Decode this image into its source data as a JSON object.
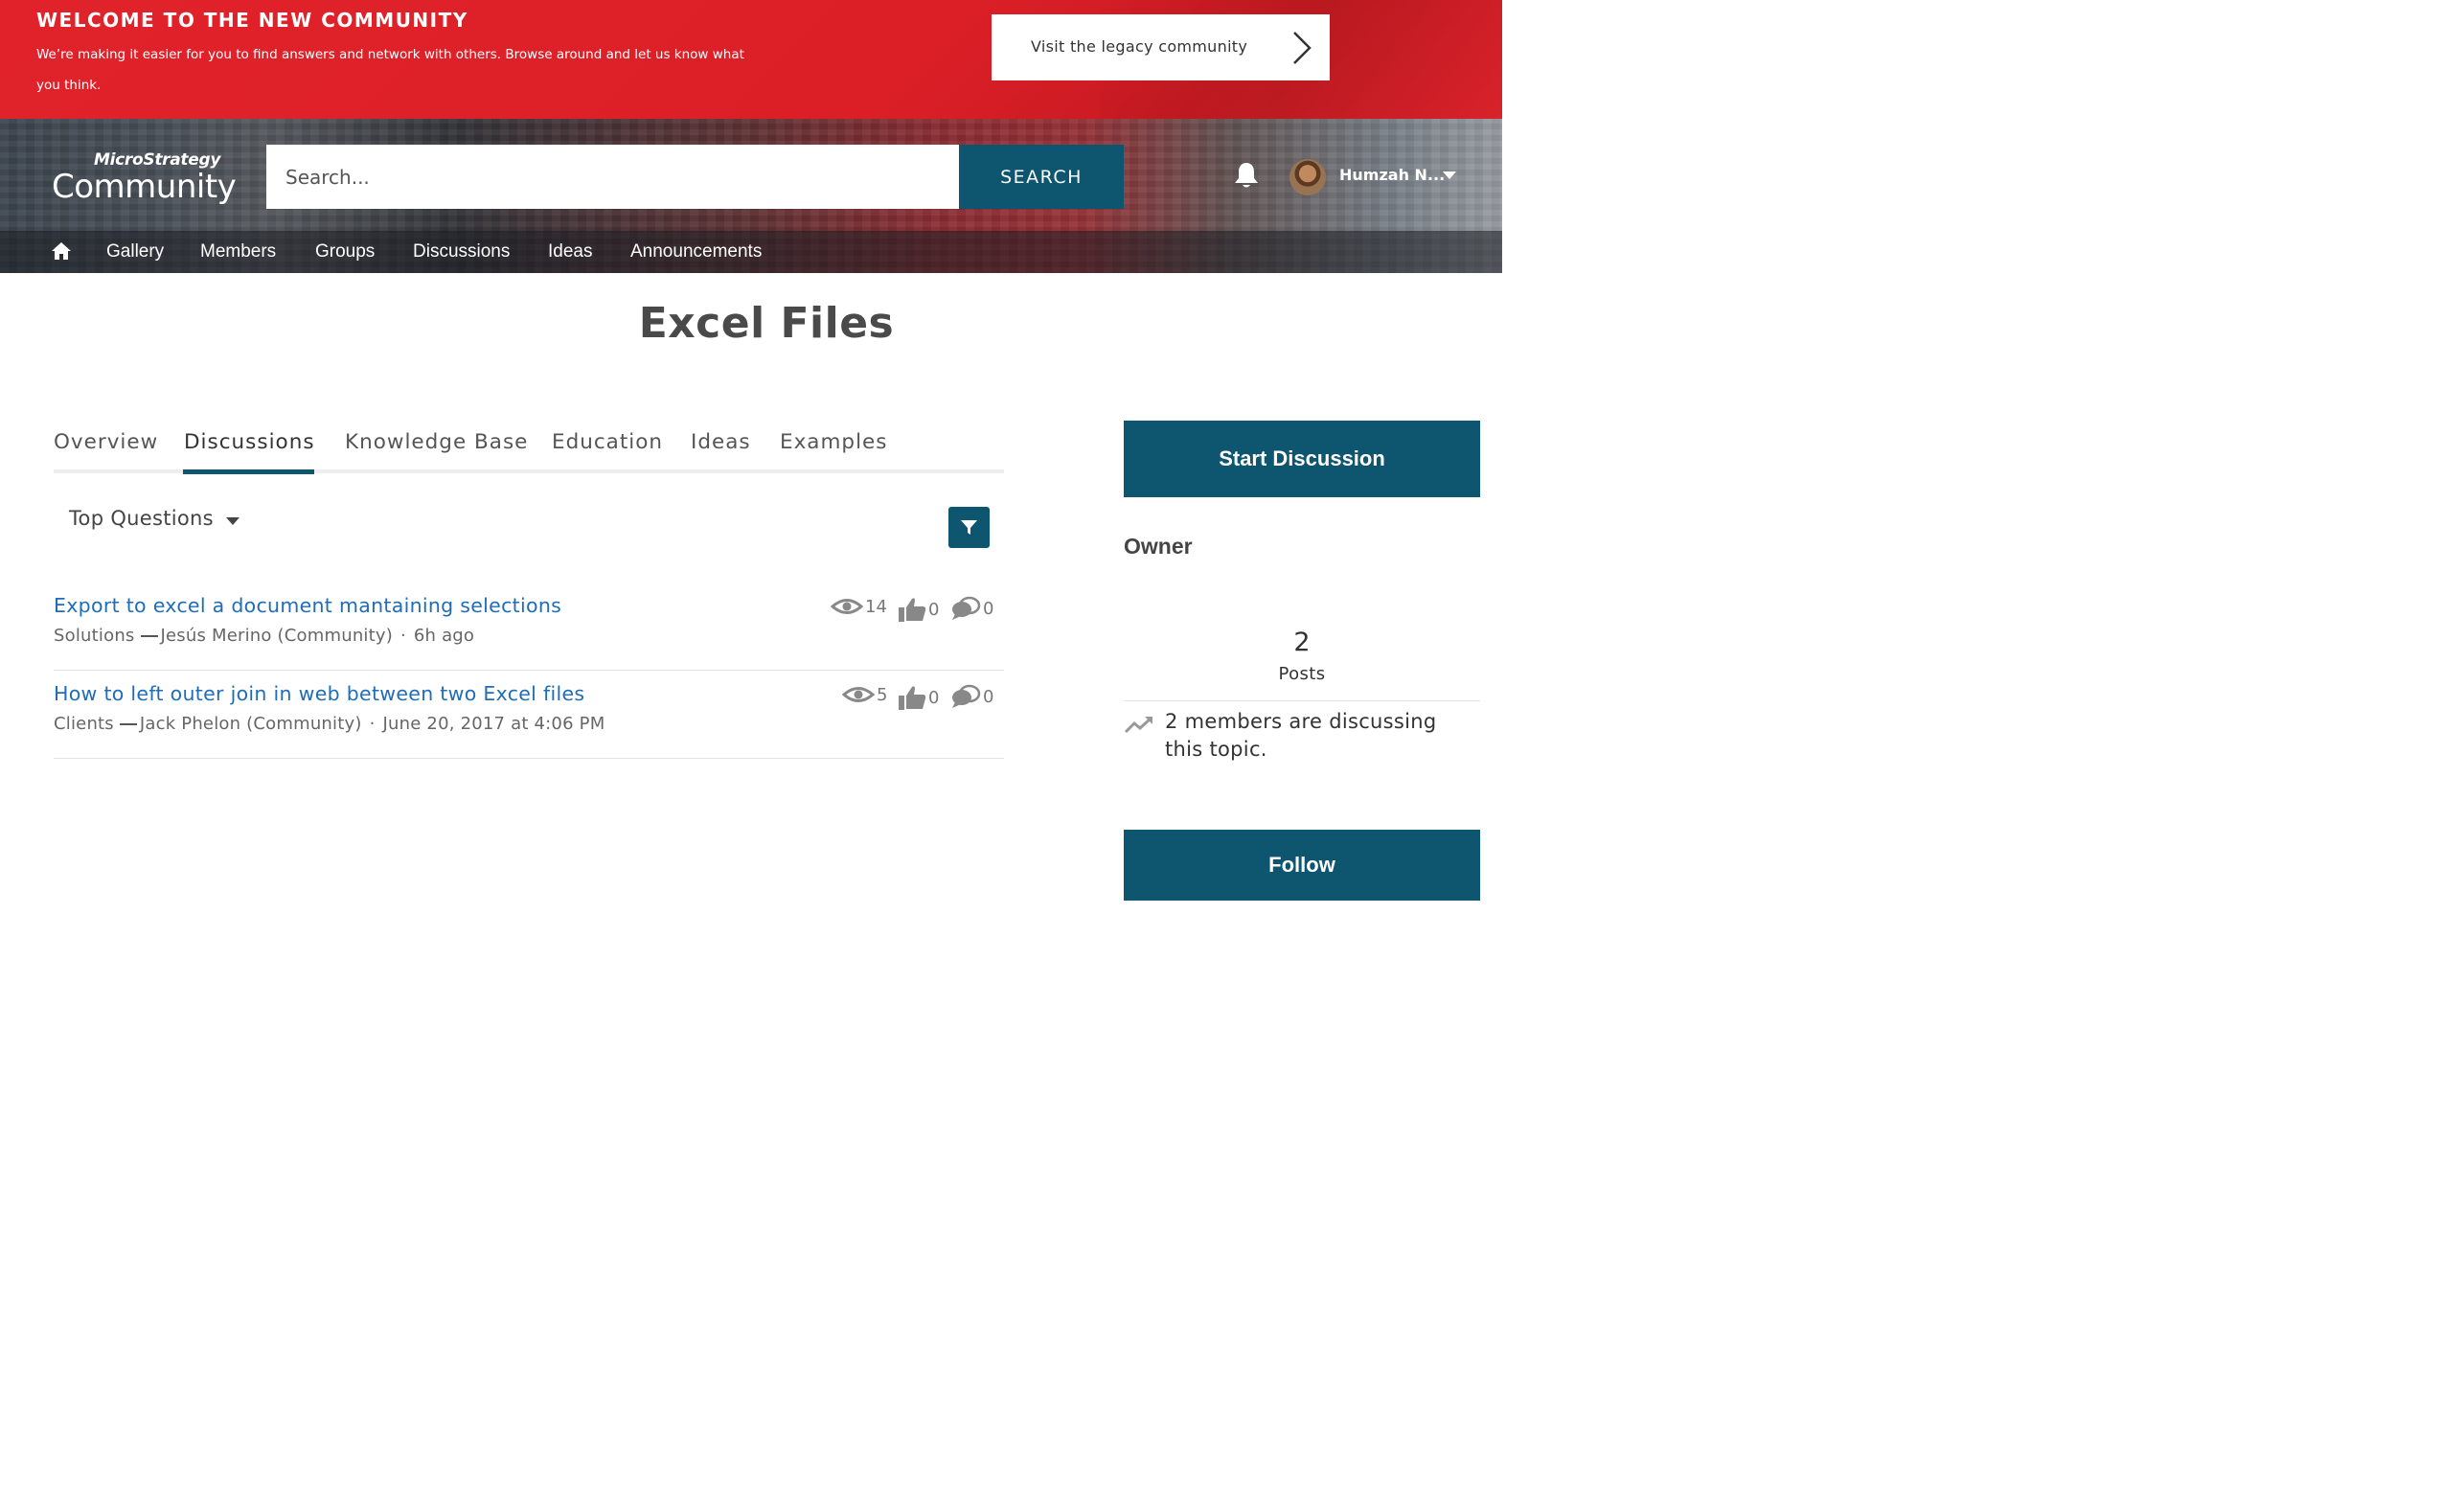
{
  "banner": {
    "title": "WELCOME TO THE NEW COMMUNITY",
    "text": "We’re making it easier for you to find answers and network with others. Browse around and let us know what you think.",
    "legacy_button": "Visit the legacy community"
  },
  "header": {
    "logo_top": "MicroStrategy",
    "logo_bottom": "Community",
    "search": {
      "placeholder": "Search...",
      "button": "SEARCH"
    },
    "user": {
      "name": "Humzah N..."
    }
  },
  "nav": {
    "items": [
      {
        "label": "Gallery"
      },
      {
        "label": "Members"
      },
      {
        "label": "Groups"
      },
      {
        "label": "Discussions"
      },
      {
        "label": "Ideas"
      },
      {
        "label": "Announcements"
      }
    ]
  },
  "page": {
    "title": "Excel Files"
  },
  "tabs": [
    {
      "label": "Overview",
      "active": false
    },
    {
      "label": "Discussions",
      "active": true
    },
    {
      "label": "Knowledge Base",
      "active": false
    },
    {
      "label": "Education",
      "active": false
    },
    {
      "label": "Ideas",
      "active": false
    },
    {
      "label": "Examples",
      "active": false
    }
  ],
  "sort": {
    "label": "Top Questions"
  },
  "discussions": [
    {
      "title": "Export to excel a document mantaining selections",
      "topic": "Solutions",
      "author": "Jesús Merino (Community)",
      "time": "6h ago",
      "views": "14",
      "likes": "0",
      "replies": "0"
    },
    {
      "title": "How to left outer join in web between two Excel files",
      "topic": "Clients",
      "author": "Jack Phelon (Community)",
      "time": "June 20, 2017 at 4:06 PM",
      "views": "5",
      "likes": "0",
      "replies": "0"
    }
  ],
  "sidebar": {
    "start_button": "Start Discussion",
    "owner_heading": "Owner",
    "posts_count": "2",
    "posts_label": "Posts",
    "members_text": "2 members are discussing this topic.",
    "follow_button": "Follow"
  },
  "colors": {
    "banner_red": "#dc1f27",
    "accent_teal": "#0e5570",
    "link_blue": "#1f6db8"
  }
}
